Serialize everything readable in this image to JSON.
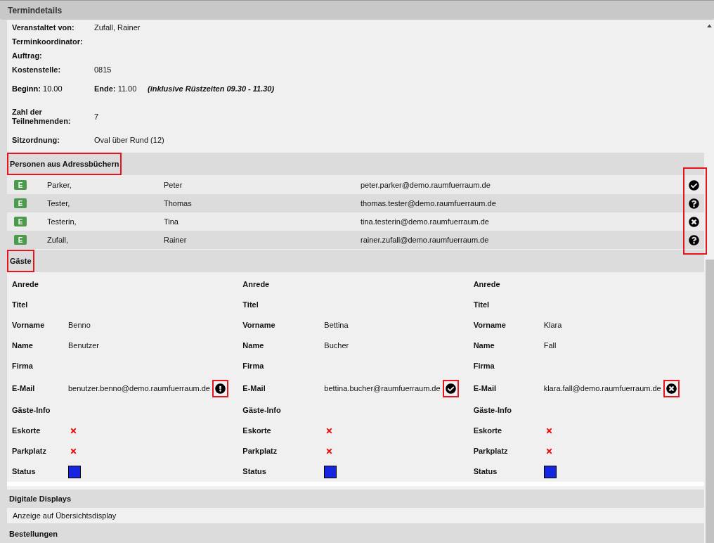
{
  "window": {
    "title": "Termindetails"
  },
  "details": [
    {
      "label": "Veranstaltet von:",
      "value": "Zufall, Rainer"
    },
    {
      "label": "Terminkoordinator:"
    },
    {
      "label": "Auftrag:"
    },
    {
      "label": "Kostenstelle:",
      "value": "0815"
    },
    {
      "kind": "times",
      "begin_label": "Beginn:",
      "begin": "10.00",
      "end_label": "Ende:",
      "end": "11.00",
      "note": "(inklusive Rüstzeiten 09.30 - 11.30)"
    },
    {
      "label": "Zahl der Teilnehmenden:",
      "value": "7"
    },
    {
      "label": "Sitzordnung:",
      "value": "Oval über Rund (12)"
    }
  ],
  "persons": {
    "heading": "Personen aus Adressbüchern",
    "heading_highlighted": true,
    "status_column_highlighted": true,
    "rows": [
      {
        "kind": "accepted",
        "badge": "E",
        "last_name": "Parker,",
        "first_name": "Peter",
        "email": "peter.parker@demo.raumfuerraum.de"
      },
      {
        "kind": "unknown",
        "badge": "E",
        "last_name": "Tester,",
        "first_name": "Thomas",
        "email": "thomas.tester@demo.raumfuerraum.de"
      },
      {
        "kind": "declined",
        "badge": "E",
        "last_name": "Testerin,",
        "first_name": "Tina",
        "email": "tina.testerin@demo.raumfuerraum.de"
      },
      {
        "kind": "unknown",
        "badge": "E",
        "last_name": "Zufall,",
        "first_name": "Rainer",
        "email": "rainer.zufall@demo.raumfuerraum.de"
      }
    ]
  },
  "guests": {
    "heading": "Gäste",
    "heading_highlighted": true,
    "items": [
      {
        "fields": [
          {
            "kind": "text",
            "label": "Anrede"
          },
          {
            "kind": "text",
            "label": "Titel"
          },
          {
            "kind": "text",
            "label": "Vorname",
            "value": "Benno"
          },
          {
            "kind": "text",
            "label": "Name",
            "value": "Benutzer"
          },
          {
            "kind": "text",
            "label": "Firma"
          },
          {
            "kind": "email",
            "label": "E-Mail",
            "value": "benutzer.benno@demo.raumfuerraum.de",
            "icon": {
              "kind": "warning",
              "highlighted": true
            }
          },
          {
            "kind": "text",
            "label": "Gäste-Info"
          },
          {
            "kind": "flag",
            "label": "Eskorte",
            "checked": false
          },
          {
            "kind": "flag",
            "label": "Parkplatz",
            "checked": false
          },
          {
            "kind": "status",
            "label": "Status",
            "color": "#1426e0"
          }
        ]
      },
      {
        "fields": [
          {
            "kind": "text",
            "label": "Anrede"
          },
          {
            "kind": "text",
            "label": "Titel"
          },
          {
            "kind": "text",
            "label": "Vorname",
            "value": "Bettina"
          },
          {
            "kind": "text",
            "label": "Name",
            "value": "Bucher"
          },
          {
            "kind": "text",
            "label": "Firma"
          },
          {
            "kind": "email",
            "label": "E-Mail",
            "value": "bettina.bucher@raumfuerraum.de",
            "icon": {
              "kind": "accepted",
              "highlighted": true
            }
          },
          {
            "kind": "text",
            "label": "Gäste-Info"
          },
          {
            "kind": "flag",
            "label": "Eskorte",
            "checked": false
          },
          {
            "kind": "flag",
            "label": "Parkplatz",
            "checked": false
          },
          {
            "kind": "status",
            "label": "Status",
            "color": "#1426e0"
          }
        ]
      },
      {
        "fields": [
          {
            "kind": "text",
            "label": "Anrede"
          },
          {
            "kind": "text",
            "label": "Titel"
          },
          {
            "kind": "text",
            "label": "Vorname",
            "value": "Klara"
          },
          {
            "kind": "text",
            "label": "Name",
            "value": "Fall"
          },
          {
            "kind": "text",
            "label": "Firma"
          },
          {
            "kind": "email",
            "label": "E-Mail",
            "value": "klara.fall@demo.raumfuerraum.de",
            "icon": {
              "kind": "declined",
              "highlighted": true
            }
          },
          {
            "kind": "text",
            "label": "Gäste-Info"
          },
          {
            "kind": "flag",
            "label": "Eskorte",
            "checked": false
          },
          {
            "kind": "flag",
            "label": "Parkplatz",
            "checked": false
          },
          {
            "kind": "status",
            "label": "Status",
            "color": "#1426e0"
          }
        ]
      }
    ]
  },
  "displays": {
    "heading": "Digitale Displays",
    "items": [
      "Anzeige auf Übersichtsdisplay"
    ]
  },
  "orders": {
    "heading": "Bestellungen"
  }
}
